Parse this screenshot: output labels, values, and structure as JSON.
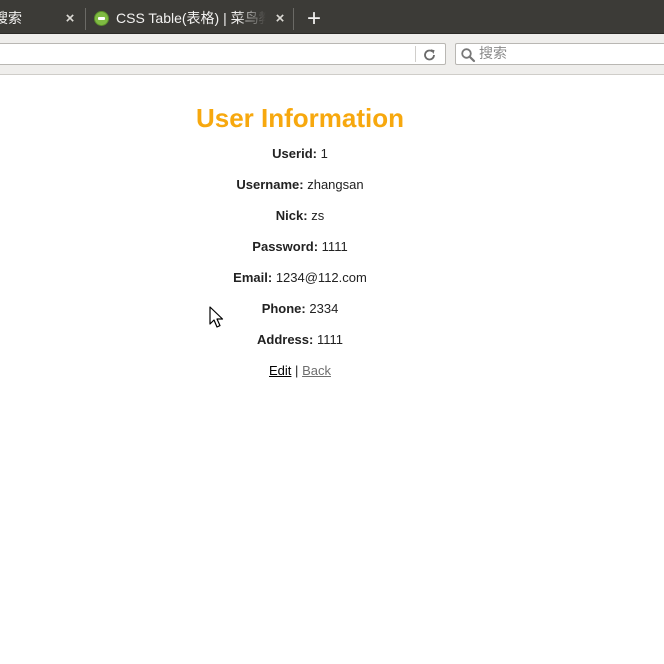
{
  "browser": {
    "tabs": [
      {
        "title": "搜索",
        "close": "×"
      },
      {
        "title": "CSS Table(表格) | 菜鸟教程",
        "close": "×"
      }
    ],
    "new_tab_label": "+",
    "search": {
      "placeholder": "搜索",
      "value": ""
    }
  },
  "page": {
    "title": "User Information",
    "fields": [
      {
        "label": "Userid:",
        "value": "1"
      },
      {
        "label": "Username:",
        "value": "zhangsan"
      },
      {
        "label": "Nick:",
        "value": "zs"
      },
      {
        "label": "Password:",
        "value": "1111"
      },
      {
        "label": "Email:",
        "value": "1234@112.com"
      },
      {
        "label": "Phone:",
        "value": "2334"
      },
      {
        "label": "Address:",
        "value": "1111"
      }
    ],
    "actions": {
      "edit": "Edit",
      "separator": "|",
      "back": "Back"
    }
  },
  "colors": {
    "title": "#f7a80e",
    "tabstrip": "#3c3b37",
    "back_link": "#6e6e6e"
  }
}
